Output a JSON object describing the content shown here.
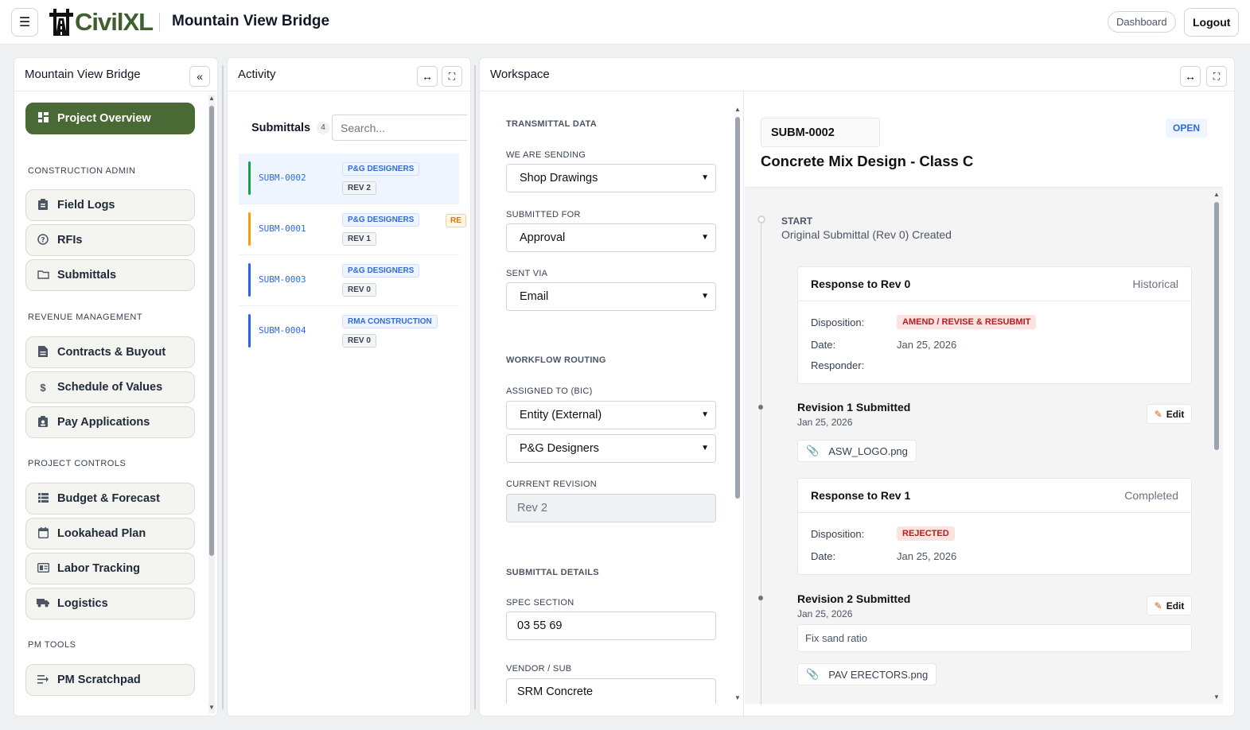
{
  "header": {
    "menu_icon": "hamburger-icon",
    "logo_text": "CivilXL",
    "title": "Mountain View Bridge",
    "dashboard_label": "Dashboard",
    "logout_label": "Logout"
  },
  "sidebar": {
    "title": "Mountain View Bridge",
    "collapse_icon": "«",
    "active_item": "Project Overview",
    "sections": {
      "construction_admin": "CONSTRUCTION ADMIN",
      "revenue_management": "REVENUE MANAGEMENT",
      "project_controls": "PROJECT CONTROLS",
      "pm_tools": "PM TOOLS"
    },
    "items": {
      "overview": "Project Overview",
      "field_logs": "Field Logs",
      "rfis": "RFIs",
      "submittals": "Submittals",
      "contracts": "Contracts & Buyout",
      "sov": "Schedule of Values",
      "pay_apps": "Pay Applications",
      "budget": "Budget & Forecast",
      "lookahead": "Lookahead Plan",
      "labor": "Labor Tracking",
      "logistics": "Logistics",
      "scratchpad": "PM Scratchpad"
    }
  },
  "activity": {
    "title": "Activity",
    "list_title": "Submittals",
    "count": "4",
    "search_placeholder": "Search...",
    "rows": [
      {
        "id": "SUBM-0002",
        "entity": "P&G DESIGNERS",
        "rev": "REV 2",
        "color": "#16a34a"
      },
      {
        "id": "SUBM-0001",
        "entity": "P&G DESIGNERS",
        "rev": "REV 1",
        "color": "#f59e0b",
        "extra": "RE"
      },
      {
        "id": "SUBM-0003",
        "entity": "P&G DESIGNERS",
        "rev": "REV 0",
        "color": "#2563eb"
      },
      {
        "id": "SUBM-0004",
        "entity": "RMA CONSTRUCTION",
        "rev": "REV 0",
        "color": "#2563eb"
      }
    ]
  },
  "workspace": {
    "title": "Workspace",
    "form": {
      "transmittal_heading": "TRANSMITTAL DATA",
      "sending_label": "WE ARE SENDING",
      "sending_value": "Shop Drawings",
      "submitted_for_label": "SUBMITTED FOR",
      "submitted_for_value": "Approval",
      "sent_via_label": "SENT VIA",
      "sent_via_value": "Email",
      "routing_heading": "WORKFLOW ROUTING",
      "assigned_label": "ASSIGNED TO (BIC)",
      "assigned_type": "Entity (External)",
      "assigned_entity": "P&G Designers",
      "revision_label": "CURRENT REVISION",
      "revision_value": "Rev 2",
      "details_heading": "SUBMITTAL DETAILS",
      "spec_label": "SPEC SECTION",
      "spec_value": "03 55 69",
      "vendor_label": "VENDOR / SUB",
      "vendor_value": "SRM Concrete"
    },
    "detail": {
      "id": "SUBM-0002",
      "status": "OPEN",
      "title": "Concrete Mix Design - Class C",
      "start_label": "START",
      "start_text": "Original Submittal (Rev 0) Created",
      "response0": {
        "title": "Response to Rev 0",
        "state": "Historical",
        "disposition_label": "Disposition:",
        "disposition": "AMEND / REVISE & RESUBMIT",
        "date_label": "Date:",
        "date": "Jan 25, 2026",
        "responder_label": "Responder:"
      },
      "rev1": {
        "title": "Revision 1 Submitted",
        "date": "Jan 25, 2026",
        "edit_label": "Edit",
        "file": "ASW_LOGO.png"
      },
      "response1": {
        "title": "Response to Rev 1",
        "state": "Completed",
        "disposition_label": "Disposition:",
        "disposition": "REJECTED",
        "date_label": "Date:",
        "date": "Jan 25, 2026"
      },
      "rev2": {
        "title": "Revision 2 Submitted",
        "date": "Jan 25, 2026",
        "edit_label": "Edit",
        "note": "Fix sand ratio",
        "file": "PAV ERECTORS.png"
      }
    }
  },
  "colors": {
    "brand_green": "#496a35",
    "link_blue": "#2f6ad8",
    "amend_bg": "#fde2e2",
    "amend_text": "#b91c1c"
  }
}
